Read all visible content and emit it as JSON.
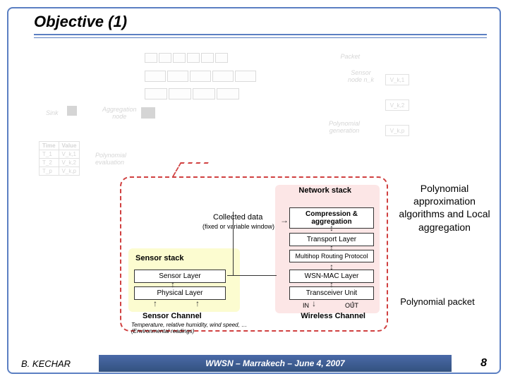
{
  "title": "Objective (1)",
  "faded": {
    "packet": "Packet",
    "sensor_node": "Sensor\nnode n_k",
    "sink": "Sink",
    "aggregation": "Aggregation\nnode",
    "polygen": "Polynomial\ngeneration",
    "polyeval": "Polynomial\nevaluation",
    "vs": [
      "V_k,1",
      "V_k,2",
      "V_k,p"
    ],
    "table_head": [
      "Time",
      "Value"
    ],
    "table_rows": [
      [
        "T_1",
        "V_k,1"
      ],
      [
        "T_2",
        "V_k,2"
      ],
      [
        "T_p",
        "V_k,p"
      ]
    ]
  },
  "callout": {
    "network_stack": "Network stack",
    "collected_data": "Collected data",
    "collected_sub": "(fixed or variable window)",
    "compression": "Compression & aggregation",
    "transport": "Transport Layer",
    "sensor_stack": "Sensor stack",
    "multihop": "Multihop Routing Protocol",
    "sensor_layer": "Sensor Layer",
    "mac_layer": "WSN-MAC Layer",
    "physical_layer": "Physical Layer",
    "transceiver": "Transceiver Unit",
    "sensor_channel": "Sensor Channel",
    "wireless_channel": "Wireless Channel",
    "in": "IN",
    "out": "OUT",
    "env": "Temperature, relative humidity, wind speed, …\n(Environmental readings)"
  },
  "annotations": {
    "right_top": "Polynomial approximation algorithms and Local aggregation",
    "right_bottom": "Polynomial packet"
  },
  "footer": {
    "author": "B. KECHAR",
    "center": "WWSN – Marrakech – June 4, 2007",
    "page": "8"
  }
}
